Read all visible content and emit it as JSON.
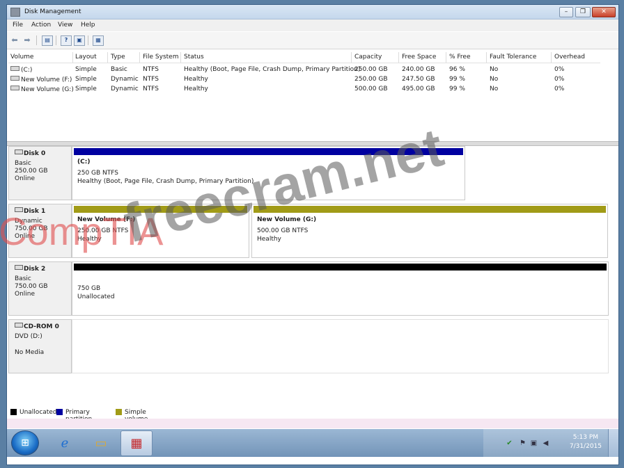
{
  "window": {
    "title": "Disk Management"
  },
  "menu": [
    "File",
    "Action",
    "View",
    "Help"
  ],
  "volume_columns": [
    "Volume",
    "Layout",
    "Type",
    "File System",
    "Status",
    "Capacity",
    "Free Space",
    "% Free",
    "Fault Tolerance",
    "Overhead"
  ],
  "volumes": [
    {
      "volume": "(C:)",
      "layout": "Simple",
      "type": "Basic",
      "fs": "NTFS",
      "status": "Healthy (Boot, Page File, Crash Dump, Primary Partition)",
      "capacity": "250.00 GB",
      "free": "240.00 GB",
      "pct": "96 %",
      "fault": "No",
      "overhead": "0%"
    },
    {
      "volume": "New Volume (F:)",
      "layout": "Simple",
      "type": "Dynamic",
      "fs": "NTFS",
      "status": "Healthy",
      "capacity": "250.00 GB",
      "free": "247.50 GB",
      "pct": "99 %",
      "fault": "No",
      "overhead": "0%"
    },
    {
      "volume": "New Volume (G:)",
      "layout": "Simple",
      "type": "Dynamic",
      "fs": "NTFS",
      "status": "Healthy",
      "capacity": "500.00 GB",
      "free": "495.00 GB",
      "pct": "99 %",
      "fault": "No",
      "overhead": "0%"
    }
  ],
  "disks": [
    {
      "name": "Disk 0",
      "lines": [
        "Basic",
        "250.00 GB",
        "Online"
      ],
      "partitions": [
        {
          "name": "(C:)",
          "lines": [
            "250 GB NTFS",
            "Healthy (Boot, Page File, Crash Dump, Primary Partition)"
          ],
          "color": "#0000a0"
        }
      ]
    },
    {
      "name": "Disk 1",
      "lines": [
        "Dynamic",
        "750.00 GB",
        "Online"
      ],
      "partitions": [
        {
          "name": "New Volume (F:)",
          "lines": [
            "250.00 GB NTFS",
            "Healthy"
          ],
          "color": "#a19b17"
        },
        {
          "name": "New Volume (G:)",
          "lines": [
            "500.00 GB NTFS",
            "Healthy"
          ],
          "color": "#a19b17"
        }
      ]
    },
    {
      "name": "Disk 2",
      "lines": [
        "Basic",
        "750.00 GB",
        "Online"
      ],
      "partitions": [
        {
          "name": "",
          "lines": [
            "750 GB",
            "Unallocated"
          ],
          "color": "#000000"
        }
      ]
    },
    {
      "name": "CD-ROM 0",
      "lines": [
        "DVD (D:)",
        "",
        "No Media"
      ],
      "partitions": []
    }
  ],
  "legend": [
    {
      "label": "Unallocated",
      "color": "#000000"
    },
    {
      "label": "Primary partition",
      "color": "#0000a0"
    },
    {
      "label": "Simple volume",
      "color": "#a19b17"
    }
  ],
  "taskbar": {
    "time": "5:13 PM",
    "date": "7/31/2015"
  },
  "watermark": {
    "brand": "CompTIA",
    "site": "freecram.net"
  },
  "icons": [
    "back-arrow-icon",
    "forward-arrow-icon",
    "console-tree-icon",
    "help-icon",
    "properties-icon",
    "refresh-icon",
    "windows-start-icon",
    "internet-explorer-icon",
    "file-explorer-icon",
    "toolbox-icon"
  ]
}
